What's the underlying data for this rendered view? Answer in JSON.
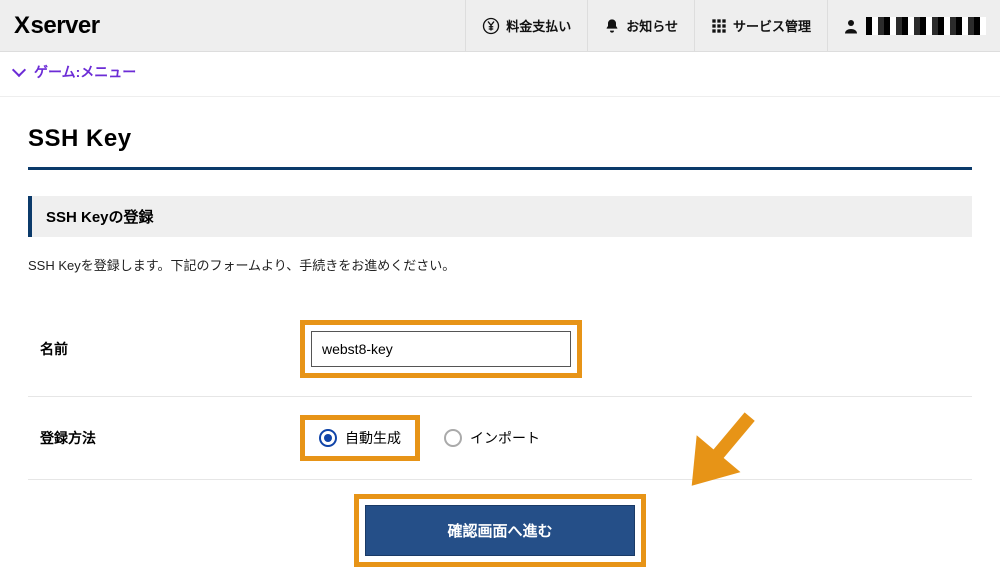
{
  "header": {
    "logo_text": "server",
    "payment_label": "料金支払い",
    "news_label": "お知らせ",
    "services_label": "サービス管理"
  },
  "breadcrumb": {
    "label": "ゲーム:メニュー"
  },
  "page": {
    "title": "SSH Key",
    "panel_heading": "SSH Keyの登録",
    "description": "SSH Keyを登録します。下記のフォームより、手続きをお進めください。"
  },
  "form": {
    "name_label": "名前",
    "name_value": "webst8-key",
    "method_label": "登録方法",
    "method_options": {
      "auto": "自動生成",
      "import": "インポート"
    },
    "selected_method": "auto",
    "submit_label": "確認画面へ進む"
  },
  "colors": {
    "accent": "#0b3a6a",
    "highlight": "#e79417",
    "breadcrumb": "#6c2cd6",
    "submit_bg": "#254f88"
  }
}
